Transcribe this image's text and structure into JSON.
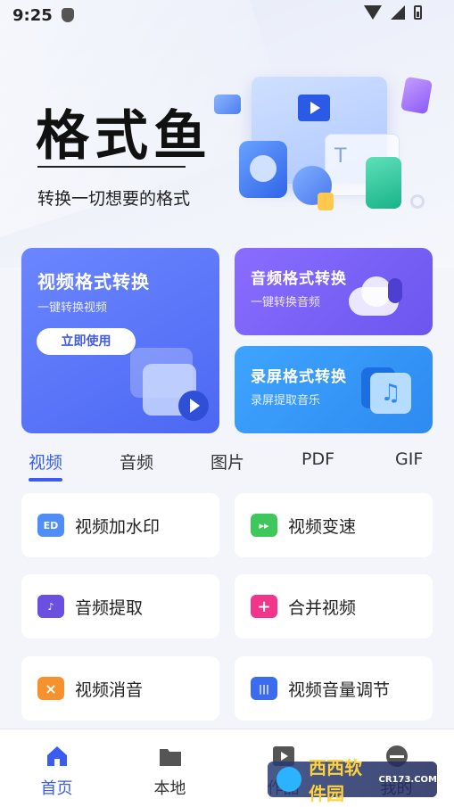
{
  "status_bar": {
    "time": "9:25"
  },
  "hero": {
    "title": "格式鱼",
    "slogan": "转换一切想要的格式"
  },
  "cards": {
    "video": {
      "title": "视频格式转换",
      "subtitle": "一键转换视频",
      "button": "立即使用"
    },
    "audio": {
      "title": "音频格式转换",
      "subtitle": "一键转换音频"
    },
    "screen": {
      "title": "录屏格式转换",
      "subtitle": "录屏提取音乐"
    }
  },
  "tabs": [
    {
      "label": "视频",
      "active": true
    },
    {
      "label": "音频",
      "active": false
    },
    {
      "label": "图片",
      "active": false
    },
    {
      "label": "PDF",
      "active": false
    },
    {
      "label": "GIF",
      "active": false
    }
  ],
  "tools": [
    {
      "label": "视频加水印",
      "icon": "watermark-icon",
      "icon_text": "ED",
      "color": "#4f8ef7"
    },
    {
      "label": "视频变速",
      "icon": "speed-icon",
      "icon_text": "▸▸",
      "color": "#3ec75a"
    },
    {
      "label": "音频提取",
      "icon": "audio-extract-icon",
      "icon_text": "♪",
      "color": "#6b4fe0"
    },
    {
      "label": "合并视频",
      "icon": "merge-video-icon",
      "icon_text": "+",
      "color": "#f0358a"
    },
    {
      "label": "视频消音",
      "icon": "mute-icon",
      "icon_text": "×",
      "color": "#f5922e"
    },
    {
      "label": "视频音量调节",
      "icon": "volume-adjust-icon",
      "icon_text": "|||",
      "color": "#3b6cf0"
    }
  ],
  "bottom_nav": [
    {
      "label": "首页",
      "icon": "home-icon",
      "active": true
    },
    {
      "label": "本地",
      "icon": "folder-icon",
      "active": false
    },
    {
      "label": "作品",
      "icon": "works-icon",
      "active": false
    },
    {
      "label": "我的",
      "icon": "profile-icon",
      "active": false
    }
  ],
  "watermark": {
    "text": "西西软件园",
    "sub": "CR173.COM"
  },
  "colors": {
    "accent": "#3b5cf0",
    "video_card": "#5a75f8",
    "audio_card": "#7a60f6",
    "screen_card": "#3598f8"
  }
}
